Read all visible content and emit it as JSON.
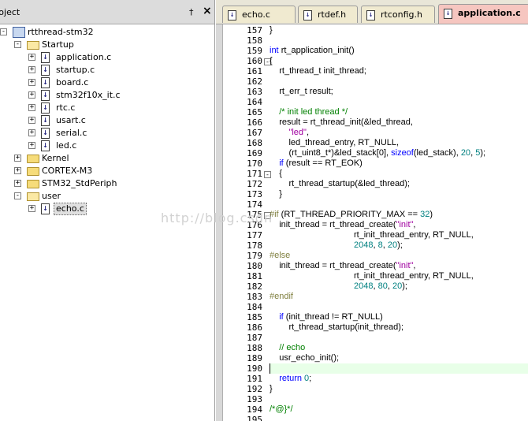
{
  "panel": {
    "title": "roject",
    "pin": "†",
    "close": "×"
  },
  "tree": [
    {
      "label": "rtthread-stm32",
      "type": "root",
      "toggle": "-"
    },
    {
      "label": "Startup",
      "type": "folder-open",
      "toggle": "-"
    },
    {
      "label": "application.c",
      "type": "file",
      "toggle": "+"
    },
    {
      "label": "startup.c",
      "type": "file",
      "toggle": "+"
    },
    {
      "label": "board.c",
      "type": "file",
      "toggle": "+"
    },
    {
      "label": "stm32f10x_it.c",
      "type": "file",
      "toggle": "+"
    },
    {
      "label": "rtc.c",
      "type": "file",
      "toggle": "+"
    },
    {
      "label": "usart.c",
      "type": "file",
      "toggle": "+"
    },
    {
      "label": "serial.c",
      "type": "file",
      "toggle": "+"
    },
    {
      "label": "led.c",
      "type": "file",
      "toggle": "+"
    },
    {
      "label": "Kernel",
      "type": "folder",
      "toggle": "+"
    },
    {
      "label": "CORTEX-M3",
      "type": "folder",
      "toggle": "+"
    },
    {
      "label": "STM32_StdPeriph",
      "type": "folder",
      "toggle": "+"
    },
    {
      "label": "user",
      "type": "folder-open",
      "toggle": "-"
    },
    {
      "label": "echo.c",
      "type": "file",
      "toggle": "+",
      "selected": true
    }
  ],
  "tabs": [
    {
      "label": "echo.c",
      "active": false
    },
    {
      "label": "rtdef.h",
      "active": false
    },
    {
      "label": "rtconfig.h",
      "active": false
    },
    {
      "label": "application.c",
      "active": true
    }
  ],
  "editor": {
    "watermark": "http://blog.csdn",
    "current_line": 190,
    "lines": [
      {
        "n": "157",
        "fold": "",
        "text": "}"
      },
      {
        "n": "158",
        "fold": "",
        "text": ""
      },
      {
        "n": "159",
        "fold": "",
        "text": "int rt_application_init()"
      },
      {
        "n": "160",
        "fold": "-",
        "text": "{"
      },
      {
        "n": "161",
        "fold": "",
        "text": "    rt_thread_t init_thread;"
      },
      {
        "n": "162",
        "fold": "",
        "text": ""
      },
      {
        "n": "163",
        "fold": "",
        "text": "    rt_err_t result;"
      },
      {
        "n": "164",
        "fold": "",
        "text": ""
      },
      {
        "n": "165",
        "fold": "",
        "text": "    /* init led thread */"
      },
      {
        "n": "166",
        "fold": "",
        "text": "    result = rt_thread_init(&led_thread,"
      },
      {
        "n": "167",
        "fold": "",
        "text": "        \"led\","
      },
      {
        "n": "168",
        "fold": "",
        "text": "        led_thread_entry, RT_NULL,"
      },
      {
        "n": "169",
        "fold": "",
        "text": "        (rt_uint8_t*)&led_stack[0], sizeof(led_stack), 20, 5);"
      },
      {
        "n": "170",
        "fold": "",
        "text": "    if (result == RT_EOK)"
      },
      {
        "n": "171",
        "fold": "-",
        "text": "    {"
      },
      {
        "n": "172",
        "fold": "",
        "text": "        rt_thread_startup(&led_thread);"
      },
      {
        "n": "173",
        "fold": "",
        "text": "    }"
      },
      {
        "n": "174",
        "fold": "",
        "text": ""
      },
      {
        "n": "175",
        "fold": "-",
        "text": "#if (RT_THREAD_PRIORITY_MAX == 32)"
      },
      {
        "n": "176",
        "fold": "",
        "text": "    init_thread = rt_thread_create(\"init\","
      },
      {
        "n": "177",
        "fold": "",
        "text": "                                   rt_init_thread_entry, RT_NULL,"
      },
      {
        "n": "178",
        "fold": "",
        "text": "                                   2048, 8, 20);"
      },
      {
        "n": "179",
        "fold": "",
        "text": "#else"
      },
      {
        "n": "180",
        "fold": "",
        "text": "    init_thread = rt_thread_create(\"init\","
      },
      {
        "n": "181",
        "fold": "",
        "text": "                                   rt_init_thread_entry, RT_NULL,"
      },
      {
        "n": "182",
        "fold": "",
        "text": "                                   2048, 80, 20);"
      },
      {
        "n": "183",
        "fold": "",
        "text": "#endif"
      },
      {
        "n": "184",
        "fold": "",
        "text": ""
      },
      {
        "n": "185",
        "fold": "",
        "text": "    if (init_thread != RT_NULL)"
      },
      {
        "n": "186",
        "fold": "",
        "text": "        rt_thread_startup(init_thread);"
      },
      {
        "n": "187",
        "fold": "",
        "text": ""
      },
      {
        "n": "188",
        "fold": "",
        "text": "    // echo"
      },
      {
        "n": "189",
        "fold": "",
        "text": "    usr_echo_init();"
      },
      {
        "n": "190",
        "fold": "",
        "text": ""
      },
      {
        "n": "191",
        "fold": "",
        "text": "    return 0;"
      },
      {
        "n": "192",
        "fold": "",
        "text": "}"
      },
      {
        "n": "193",
        "fold": "",
        "text": ""
      },
      {
        "n": "194",
        "fold": "",
        "text": "/*@}*/"
      },
      {
        "n": "195",
        "fold": "",
        "text": ""
      }
    ]
  },
  "colors": {
    "keyword": "#0000ff",
    "comment": "#008000",
    "preprocessor": "#808040",
    "string": "#a000a0",
    "number": "#008080",
    "active_tab": "#f6c6c0",
    "tab": "#f0ead0"
  }
}
